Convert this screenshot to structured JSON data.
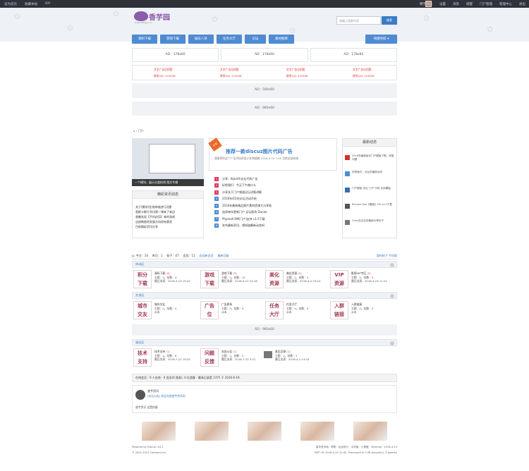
{
  "topbar": {
    "links": [
      "设为首页",
      "收藏本站",
      "DIY"
    ],
    "user": "腾宇资讯",
    "right": [
      "设置",
      "消息",
      "提醒",
      "门户管理",
      "管理中心",
      "退出"
    ]
  },
  "logo": {
    "title": "香芋园",
    "sub": "www.xiangyu.cn"
  },
  "search": {
    "placeholder": "请输入搜索内容",
    "button": "搜索"
  },
  "nav": {
    "items": [
      "源码下载",
      "游戏下载",
      "娱乐八卦",
      "任务大厅",
      "论坛",
      "素材图库"
    ],
    "dropdown": "快捷导航 ▾"
  },
  "ads": {
    "row": [
      "AD：178x60",
      "AD：178x60",
      "AD：178x60"
    ],
    "big1": "AD：500x60",
    "big2": "AD：960x60",
    "mid": "AD：960x60"
  },
  "text_ads": [
    {
      "a": "文字广告位招租",
      "b": "联系QQ: 123456"
    },
    {
      "a": "文字广告位招租",
      "b": "联系QQ: 123456"
    },
    {
      "a": "文字广告位招租",
      "b": "联系QQ: 123456"
    },
    {
      "a": "文字广告位招租",
      "b": "联系QQ: 123456"
    }
  ],
  "crumb": "门户",
  "slide": {
    "caption": "一个模块，展示分类检测 图文专辑"
  },
  "left_list": {
    "title": "精彩资讯动态",
    "items": [
      "关于[模块]在线商城进行迅雷",
      "奥斯卡影片资讯第一弹来了来自",
      "香魅发现【手机应用】来的游戏",
      "这部韩剧的发展方向很有意思",
      "目前精彩资讯分享"
    ]
  },
  "middle": {
    "ribbon": "头条",
    "title": "推荐一款discuz图片代码广告",
    "summary": "我推荐的这个广告代码的设计非常精美 2016-4-19 7:00 目前全部有效",
    "items": [
      "分享：Bybirth论坛代码广告",
      "好吧我们：今天下午做什么",
      "分享关于门户频道论坛详细讲解",
      "2016年4月份论坛活动开始",
      "2016年最新精品图片素材资源大分享帖",
      "连续每年更新门户 论坛版块 Dunae",
      "Phpmall RM[门户]支持 v1.5下载",
      "发布最新资讯，想知道最新动态吗"
    ]
  },
  "right": {
    "title": "最新动态",
    "items": [
      "2016年最新版本门户模板下载，修复问题",
      "好吧我们，论坛的最新动态",
      "门户模板 论坛 门户 代码 实用模板",
      "Richard Siel【模板】OK v1.0下载",
      "Chris在论坛的最新分享帖子"
    ]
  },
  "tabs": {
    "items": [
      "今日：14",
      "昨日：1",
      "帖子：47",
      "会员：11",
      "欢迎新会员",
      "最新回复"
    ],
    "right": [
      "我的帖子",
      "手机版"
    ]
  },
  "sections": [
    {
      "title": "休闲区",
      "forums": [
        {
          "icon": "积分\n下载",
          "name": "源码下载",
          "count": "(4)",
          "l1": "主题：4，帖数：4",
          "l2": "最后发表：2016-4-19 15:42"
        },
        {
          "icon": "游戏\n下载",
          "name": "游戏下载",
          "count": "(3)",
          "l1": "主题：3，帖数：10",
          "l2": "最后发表：2016-4-12 22:18"
        },
        {
          "icon": "美化\n资源",
          "name": "美化资源",
          "count": "(2)",
          "l1": "主题：2，帖数：2",
          "l2": "最后发表：2016-4-2 23:24"
        },
        {
          "icon": "VIP\n资源",
          "name": "影视VIP专区",
          "count": "(5)",
          "l1": "主题：5，帖数：5",
          "l2": "最后发表：2016-4-19 11:22"
        }
      ]
    },
    {
      "title": "交流区",
      "forums": [
        {
          "icon": "城市\n交友",
          "name": "城市交友",
          "count": "",
          "l1": "主题：0，帖数：0",
          "l2": "从未"
        },
        {
          "icon": "广告\n位",
          "name": "广告联系",
          "count": "",
          "l1": "主题：0，帖数：0",
          "l2": "从未"
        },
        {
          "icon": "任务\n大厅",
          "name": "任务大厅",
          "count": "",
          "l1": "主题：0，帖数：0",
          "l2": "从未"
        },
        {
          "icon": "入群\n链接",
          "name": "入群链接",
          "count": "",
          "l1": "主题：0，帖数：0",
          "l2": "从未"
        }
      ]
    },
    {
      "title": "服务区",
      "forums": [
        {
          "icon": "技术\n支持",
          "name": "技术支持",
          "count": "(1)",
          "l1": "主题：4，帖数：6",
          "l2": "最后发表：2016-7-22 19:32"
        },
        {
          "icon": "问题\n反馈",
          "name": "站务公告",
          "count": "(1)",
          "l1": "主题：2，帖数：2",
          "l2": "最后发表：2016-7-22 3:21"
        },
        {
          "icon": "",
          "name": "意见反馈",
          "count": "(1)",
          "l1": "主题：2，帖数：2",
          "l2": "最后发表：2016-4-2 14:34"
        }
      ]
    }
  ],
  "stats": "在线会员 - 0 人在线 - 0 会员(0 隐身), 0 位游客 - 最高记录是 1375 于 2016-6-19.",
  "shout": {
    "user": "香芋资讯",
    "msg": "[论坛公告] 欢迎光临香芋资讯网",
    "links": [
      "香芋资讯",
      "设置快捷"
    ]
  },
  "footer": {
    "left1": "Powered by Discuz! X3.2",
    "left2": "© 2001-2013 Comsenz Inc.",
    "right1": "香芋资讯网 · 帮助 · 站点统计 · 手机版 · 小黑屋 · Sitemap · 2016-4-19",
    "right2": "GMT+8, 2016-4-19 21:42, Processed in 0.08 second(s), 3 queries"
  }
}
